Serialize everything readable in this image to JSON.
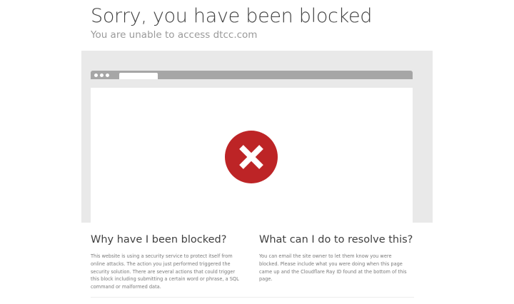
{
  "header": {
    "title": "Sorry, you have been blocked",
    "subtitle": "You are unable to access dtcc.com"
  },
  "illustration": {
    "icon": "error-x-circle-icon",
    "colors": {
      "circle": "#bd2426",
      "cross": "#ffffff",
      "stage": "#e9e9e9",
      "bar": "#a6a6a6"
    }
  },
  "why": {
    "heading": "Why have I been blocked?",
    "body": "This website is using a security service to protect itself from online attacks. The action you just performed triggered the security solution. There are several actions that could trigger this block including submitting a certain word or phrase, a SQL command or malformed data."
  },
  "resolve": {
    "heading": "What can I do to resolve this?",
    "body": "You can email the site owner to let them know you were blocked. Please include what you were doing when this page came up and the Cloudflare Ray ID found at the bottom of this page."
  }
}
